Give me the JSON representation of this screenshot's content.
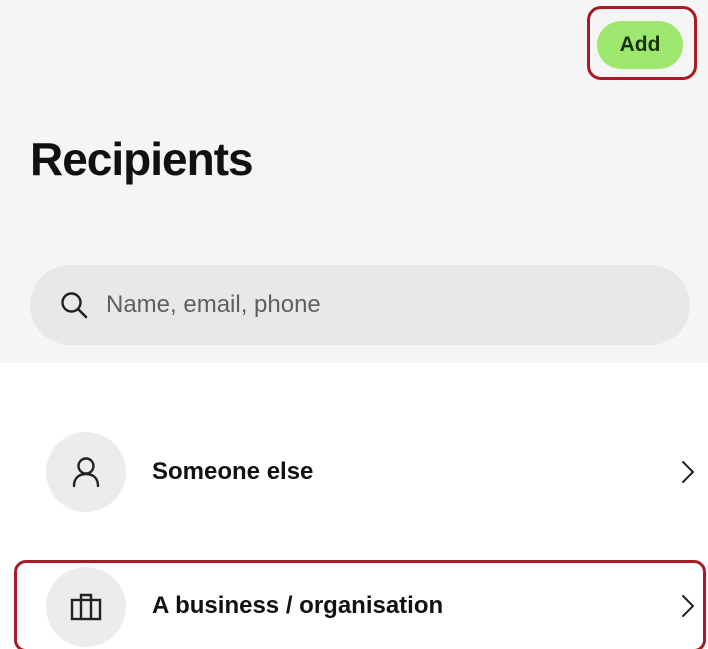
{
  "header": {
    "add_label": "Add",
    "title": "Recipients"
  },
  "search": {
    "placeholder": "Name, email, phone"
  },
  "options": [
    {
      "label": "Someone else",
      "icon": "person-icon"
    },
    {
      "label": "A business / organisation",
      "icon": "briefcase-icon"
    }
  ],
  "colors": {
    "accent": "#9fe870",
    "accent_text": "#163300",
    "highlight": "#a51c24",
    "panel_bg": "#f5f5f5",
    "search_bg": "#e8e8e8"
  }
}
